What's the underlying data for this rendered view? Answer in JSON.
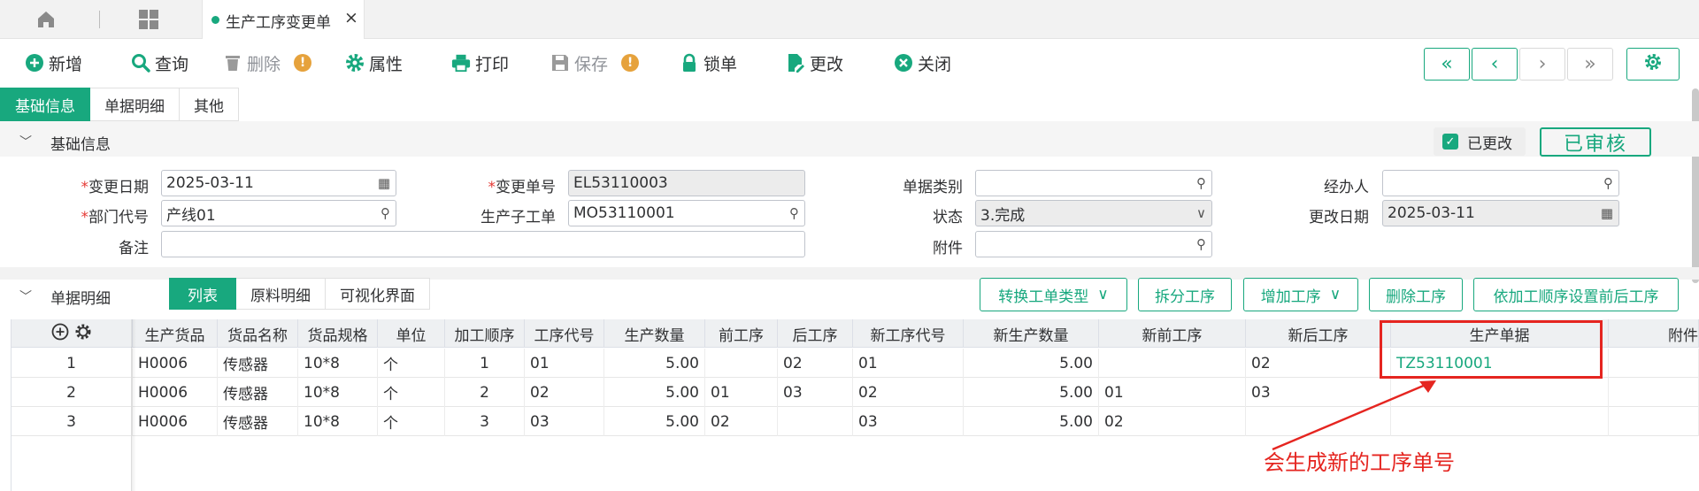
{
  "tabbar": {
    "tab_label": "生产工序变更单",
    "close": "×"
  },
  "toolbar": {
    "buttons": [
      {
        "label": "新增",
        "icon": "plus-circle-icon"
      },
      {
        "label": "查询",
        "icon": "search-icon"
      },
      {
        "label": "删除",
        "icon": "trash-icon",
        "disabled": true
      },
      {
        "label": "属性",
        "icon": "gear-icon"
      },
      {
        "label": "打印",
        "icon": "printer-icon"
      },
      {
        "label": "保存",
        "icon": "save-icon",
        "disabled": true
      },
      {
        "label": "锁单",
        "icon": "lock-icon"
      },
      {
        "label": "更改",
        "icon": "edit-doc-icon"
      },
      {
        "label": "关闭",
        "icon": "close-circle-icon"
      }
    ],
    "warn_mark": "!",
    "nav": [
      "«",
      "‹",
      "›",
      "»"
    ]
  },
  "subtabs": [
    "基础信息",
    "单据明细",
    "其他"
  ],
  "basic": {
    "section_title": "基础信息",
    "changed_label": "已更改",
    "stamp": "已审核",
    "fields": {
      "change_date_label": "变更日期",
      "change_date": "2025-03-11",
      "change_no_label": "变更单号",
      "change_no": "EL53110003",
      "doc_type_label": "单据类别",
      "doc_type": "",
      "handler_label": "经办人",
      "handler": "",
      "dept_label": "部门代号",
      "dept": "产线01",
      "sub_order_label": "生产子工单",
      "sub_order": "MO53110001",
      "status_label": "状态",
      "status": "3.完成",
      "modify_date_label": "更改日期",
      "modify_date": "2025-03-11",
      "remark_label": "备注",
      "remark": "",
      "attach_label": "附件",
      "attach": ""
    }
  },
  "detail": {
    "section_title": "单据明细",
    "views": [
      "列表",
      "原料明细",
      "可视化界面"
    ],
    "actions": [
      {
        "label": "转换工单类型",
        "dropdown": true
      },
      {
        "label": "拆分工序",
        "dropdown": false
      },
      {
        "label": "增加工序",
        "dropdown": true
      },
      {
        "label": "删除工序",
        "dropdown": false
      },
      {
        "label": "依加工顺序设置前后工序",
        "dropdown": false
      }
    ],
    "columns": [
      "生产货品",
      "货品名称",
      "货品规格",
      "单位",
      "加工顺序",
      "工序代号",
      "生产数量",
      "前工序",
      "后工序",
      "新工序代号",
      "新生产数量",
      "新前工序",
      "新后工序",
      "生产单据",
      "附件"
    ],
    "rows": [
      {
        "no": "1",
        "cells": [
          "H0006",
          "传感器",
          "10*8",
          "个",
          "1",
          "01",
          "5.00",
          "",
          "02",
          "01",
          "5.00",
          "",
          "02",
          "TZ53110001",
          ""
        ]
      },
      {
        "no": "2",
        "cells": [
          "H0006",
          "传感器",
          "10*8",
          "个",
          "2",
          "02",
          "5.00",
          "01",
          "03",
          "02",
          "5.00",
          "01",
          "03",
          "",
          ""
        ]
      },
      {
        "no": "3",
        "cells": [
          "H0006",
          "传感器",
          "10*8",
          "个",
          "3",
          "03",
          "5.00",
          "02",
          "",
          "03",
          "5.00",
          "02",
          "",
          "",
          ""
        ]
      }
    ]
  },
  "annotation": "会生成新的工序单号",
  "colors": {
    "accent": "#18a87e",
    "warning": "#e6a23c",
    "annotation": "#e52520"
  }
}
